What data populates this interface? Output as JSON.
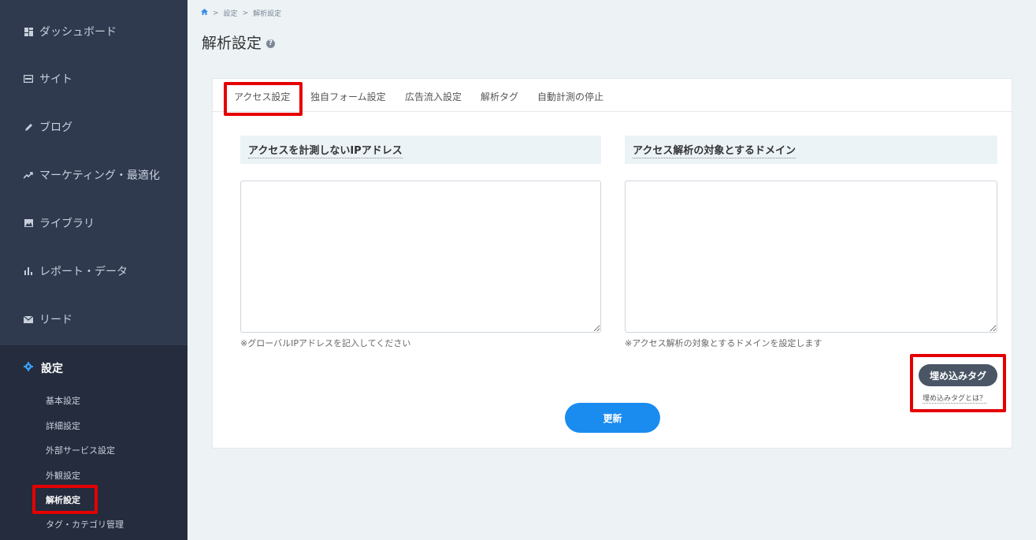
{
  "sidebar": {
    "items": [
      {
        "label": "ダッシュボード",
        "icon": "dashboard-icon"
      },
      {
        "label": "サイト",
        "icon": "site-icon"
      },
      {
        "label": "ブログ",
        "icon": "pencil-icon"
      },
      {
        "label": "マーケティング・最適化",
        "icon": "trend-icon"
      },
      {
        "label": "ライブラリ",
        "icon": "image-icon"
      },
      {
        "label": "レポート・データ",
        "icon": "bar-chart-icon"
      },
      {
        "label": "リード",
        "icon": "mail-icon"
      }
    ],
    "settings": {
      "label": "設定",
      "icon": "gear-icon",
      "subitems": [
        "基本設定",
        "詳細設定",
        "外部サービス設定",
        "外観設定",
        "解析設定",
        "タグ・カテゴリ管理"
      ],
      "active_subitem": "解析設定"
    }
  },
  "breadcrumb": [
    "設定",
    "解析設定"
  ],
  "page": {
    "title": "解析設定",
    "tabs": [
      "アクセス設定",
      "独自フォーム設定",
      "広告流入設定",
      "解析タグ",
      "自動計測の停止"
    ],
    "active_tab": "アクセス設定"
  },
  "form": {
    "ip_section_title": "アクセスを計測しないIPアドレス",
    "ip_value": "",
    "ip_hint": "※グローバルIPアドレスを記入してください",
    "domain_section_title": "アクセス解析の対象とするドメイン",
    "domain_value": "",
    "domain_hint": "※アクセス解析の対象とするドメインを設定します",
    "embed_button": "埋め込みタグ",
    "embed_link": "埋め込みタグとは？",
    "update_button": "更新"
  },
  "colors": {
    "sidebar_bg": "#2f3a4f",
    "accent": "#1a8cf0",
    "highlight": "#e50000"
  }
}
